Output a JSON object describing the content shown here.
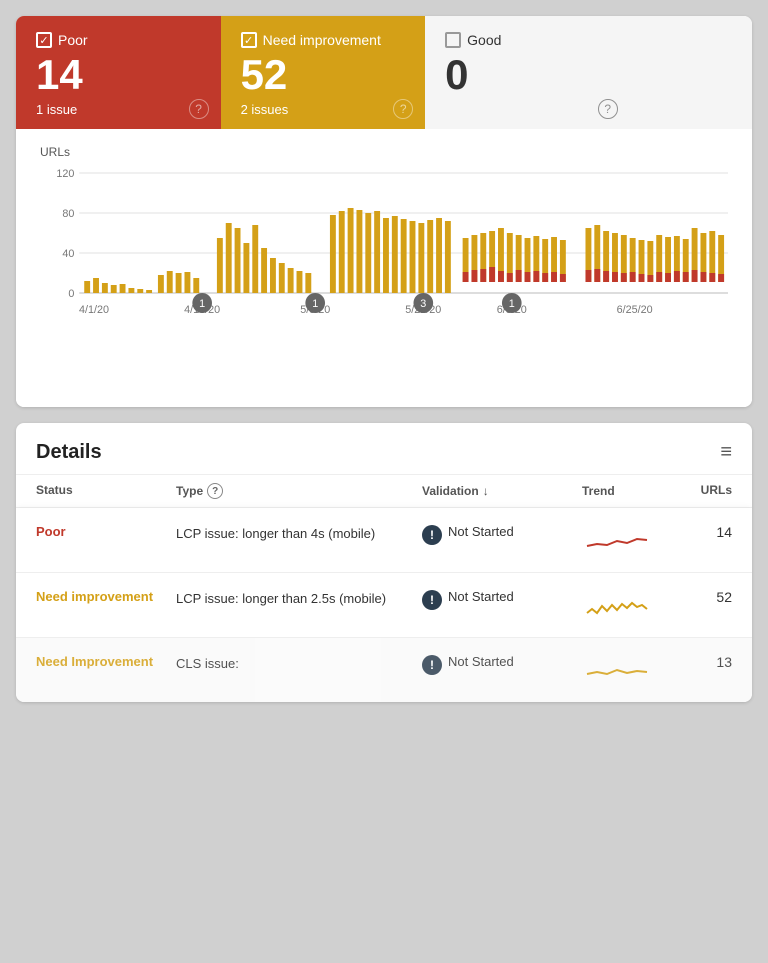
{
  "tiles": [
    {
      "id": "poor",
      "label": "Poor",
      "number": "14",
      "sub": "1 issue",
      "checked": true,
      "style": "poor"
    },
    {
      "id": "need-improvement",
      "label": "Need improvement",
      "number": "52",
      "sub": "2 issues",
      "checked": true,
      "style": "need"
    },
    {
      "id": "good",
      "label": "Good",
      "number": "0",
      "sub": "",
      "checked": false,
      "style": "good"
    }
  ],
  "chart": {
    "yLabel": "URLs",
    "yTicks": [
      "120",
      "80",
      "40",
      "0"
    ],
    "xTicks": [
      "4/1/20",
      "4/18/20",
      "5/5/20",
      "5/22/20",
      "6/8/20",
      "6/25/20"
    ],
    "annotations": [
      "1",
      "1",
      "3",
      "1"
    ]
  },
  "details": {
    "title": "Details",
    "filterIcon": "≡",
    "columns": {
      "status": "Status",
      "type": "Type",
      "validation": "Validation",
      "trend": "Trend",
      "urls": "URLs"
    },
    "rows": [
      {
        "status": "Poor",
        "statusStyle": "poor",
        "type": "LCP issue: longer than 4s (mobile)",
        "validation": "Not Started",
        "trend": "poor",
        "urls": "14"
      },
      {
        "status": "Need improvement",
        "statusStyle": "need",
        "type": "LCP issue: longer than 2.5s (mobile)",
        "validation": "Not Started",
        "trend": "need",
        "urls": "52"
      },
      {
        "status": "Need Improvement",
        "statusStyle": "need",
        "type": "CLS issue:",
        "validation": "Not Started",
        "trend": "need2",
        "urls": "13"
      }
    ]
  }
}
